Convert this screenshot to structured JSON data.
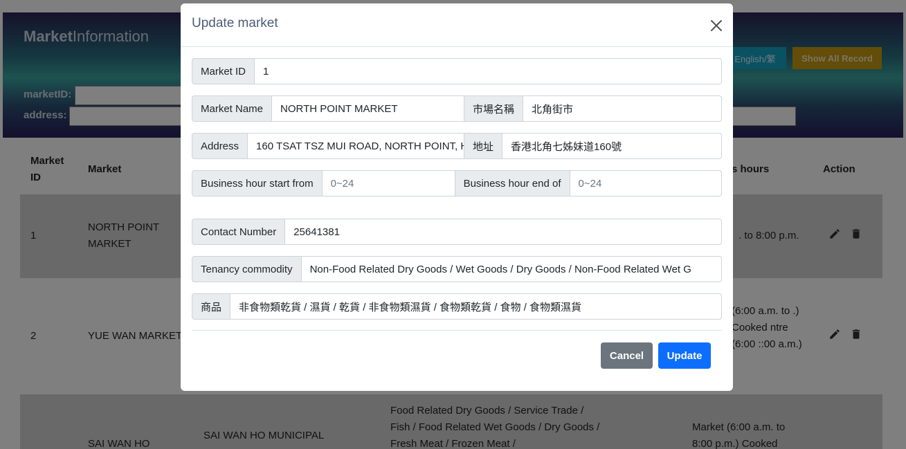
{
  "app": {
    "brand_bold": "Market",
    "brand_rest": "Information",
    "lang_button": "English/繁",
    "show_all_button": "Show All Record",
    "filters": [
      {
        "label": "marketID:"
      },
      {
        "label": "address:"
      }
    ]
  },
  "table": {
    "headers": {
      "market_id": "Market ID",
      "market": "Market",
      "business_hours": "s hours",
      "action": "Action"
    },
    "rows": [
      {
        "id": "1",
        "market": "NORTH POINT MARKET",
        "hours": ". to 8:00 p.m."
      },
      {
        "id": "2",
        "market": "YUE WAN MARKET",
        "hours": "(6:00 a.m. to .) Cooked ntre (6:00 ::00 a.m.)"
      },
      {
        "id": "",
        "market": "SAI WAN HO",
        "building": "SAI WAN HO MUNICIPAL",
        "commodity": "Food Related Dry Goods / Service Trade / Fish / Food Related Wet Goods / Dry Goods / Fresh Meat / Frozen Meat /",
        "hours": "Market (6:00 a.m. to 8:00 p.m.) Cooked"
      }
    ]
  },
  "modal": {
    "title": "Update market",
    "fields": {
      "market_id": {
        "label": "Market ID",
        "value": "1"
      },
      "market_name": {
        "label": "Market Name",
        "value": "NORTH POINT MARKET"
      },
      "market_name_zh": {
        "label": "市場名稱",
        "value": "北角街市"
      },
      "address": {
        "label": "Address",
        "value": "160 TSAT TSZ MUI ROAD, NORTH POINT, H"
      },
      "address_zh": {
        "label": "地址",
        "value": "香港北角七姊妹道160號"
      },
      "hour_start": {
        "label": "Business hour start from",
        "placeholder": "0~24"
      },
      "hour_end": {
        "label": "Business hour end of",
        "placeholder": "0~24"
      },
      "contact": {
        "label": "Contact Number",
        "value": "25641381"
      },
      "tenancy": {
        "label": "Tenancy commodity",
        "value": "Non-Food Related Dry Goods / Wet Goods / Dry Goods / Non-Food Related Wet G"
      },
      "tenancy_zh": {
        "label": "商品",
        "value": "非食物類乾貨 / 濕貨 / 乾貨 / 非食物類濕貨 / 食物類乾貨 / 食物 / 食物類濕貨"
      }
    },
    "cancel_label": "Cancel",
    "update_label": "Update"
  },
  "icons": {
    "close": "close-icon",
    "edit": "pencil-icon",
    "delete": "trash-icon"
  },
  "colors": {
    "primary": "#0d6efd",
    "secondary": "#6c757d",
    "lang_button": "#14a3c4",
    "show_all_button": "#c89a10"
  }
}
